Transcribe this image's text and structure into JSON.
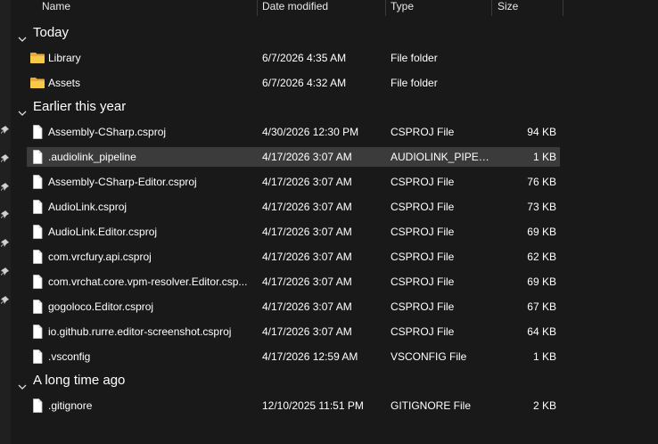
{
  "columns": {
    "name": "Name",
    "date": "Date modified",
    "type": "Type",
    "size": "Size"
  },
  "groups": [
    {
      "label": "Today",
      "rows": [
        {
          "name": "Library",
          "date": "6/7/2026 4:35 AM",
          "type": "File folder",
          "size": "",
          "icon": "folder-icon"
        },
        {
          "name": "Assets",
          "date": "6/7/2026 4:32 AM",
          "type": "File folder",
          "size": "",
          "icon": "folder-icon"
        }
      ]
    },
    {
      "label": "Earlier this year",
      "rows": [
        {
          "name": "Assembly-CSharp.csproj",
          "date": "4/30/2026 12:30 PM",
          "type": "CSPROJ File",
          "size": "94 KB",
          "icon": "file-icon"
        },
        {
          "name": ".audiolink_pipeline",
          "date": "4/17/2026 3:07 AM",
          "type": "AUDIOLINK_PIPEL...",
          "size": "1 KB",
          "icon": "file-icon",
          "selected": true
        },
        {
          "name": "Assembly-CSharp-Editor.csproj",
          "date": "4/17/2026 3:07 AM",
          "type": "CSPROJ File",
          "size": "76 KB",
          "icon": "file-icon"
        },
        {
          "name": "AudioLink.csproj",
          "date": "4/17/2026 3:07 AM",
          "type": "CSPROJ File",
          "size": "73 KB",
          "icon": "file-icon"
        },
        {
          "name": "AudioLink.Editor.csproj",
          "date": "4/17/2026 3:07 AM",
          "type": "CSPROJ File",
          "size": "69 KB",
          "icon": "file-icon"
        },
        {
          "name": "com.vrcfury.api.csproj",
          "date": "4/17/2026 3:07 AM",
          "type": "CSPROJ File",
          "size": "62 KB",
          "icon": "file-icon"
        },
        {
          "name": "com.vrchat.core.vpm-resolver.Editor.csp...",
          "date": "4/17/2026 3:07 AM",
          "type": "CSPROJ File",
          "size": "69 KB",
          "icon": "file-icon"
        },
        {
          "name": "gogoloco.Editor.csproj",
          "date": "4/17/2026 3:07 AM",
          "type": "CSPROJ File",
          "size": "67 KB",
          "icon": "file-icon"
        },
        {
          "name": "io.github.rurre.editor-screenshot.csproj",
          "date": "4/17/2026 3:07 AM",
          "type": "CSPROJ File",
          "size": "64 KB",
          "icon": "file-icon"
        },
        {
          "name": ".vsconfig",
          "date": "4/17/2026 12:59 AM",
          "type": "VSCONFIG File",
          "size": "1 KB",
          "icon": "file-icon"
        }
      ]
    },
    {
      "label": "A long time ago",
      "rows": [
        {
          "name": ".gitignore",
          "date": "12/10/2025 11:51 PM",
          "type": "GITIGNORE File",
          "size": "2 KB",
          "icon": "file-icon"
        }
      ]
    }
  ],
  "colors": {
    "background": "#191919",
    "selected_row": "#3b3b3b",
    "folder": "#f2c14e",
    "text": "#ffffff"
  }
}
